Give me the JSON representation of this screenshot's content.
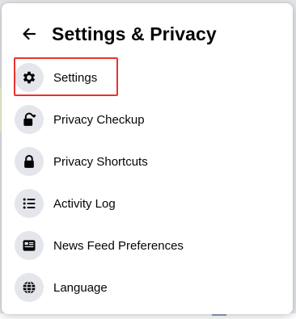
{
  "panel": {
    "title": "Settings & Privacy",
    "back_icon": "arrow-left-icon"
  },
  "menu": {
    "items": [
      {
        "label": "Settings",
        "icon": "gear-icon",
        "highlighted": true
      },
      {
        "label": "Privacy Checkup",
        "icon": "lock-heart-icon"
      },
      {
        "label": "Privacy Shortcuts",
        "icon": "lock-icon"
      },
      {
        "label": "Activity Log",
        "icon": "list-icon"
      },
      {
        "label": "News Feed Preferences",
        "icon": "news-feed-icon"
      },
      {
        "label": "Language",
        "icon": "globe-icon"
      }
    ]
  },
  "colors": {
    "highlight_border": "#e8332e",
    "icon_background": "#e4e6eb",
    "text": "#050505"
  }
}
